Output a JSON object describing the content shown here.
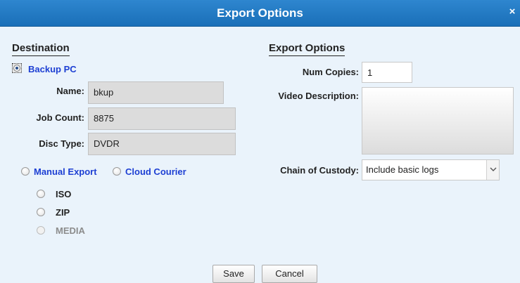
{
  "dialog": {
    "title": "Export Options",
    "close_label": "×"
  },
  "destination": {
    "heading": "Destination",
    "backup_pc": {
      "label": "Backup PC",
      "selected": true
    },
    "name_label": "Name:",
    "name_value": "bkup",
    "job_count_label": "Job Count:",
    "job_count_value": "8875",
    "disc_type_label": "Disc Type:",
    "disc_type_value": "DVDR",
    "manual_export_label": "Manual Export",
    "cloud_courier_label": "Cloud Courier",
    "formats": [
      {
        "label": "ISO",
        "enabled": true
      },
      {
        "label": "ZIP",
        "enabled": true
      },
      {
        "label": "MEDIA",
        "enabled": false
      }
    ]
  },
  "export_options": {
    "heading": "Export Options",
    "num_copies_label": "Num Copies:",
    "num_copies_value": "1",
    "video_description_label": "Video Description:",
    "video_description_value": "",
    "chain_of_custody_label": "Chain of Custody:",
    "chain_of_custody_value": "Include basic logs"
  },
  "buttons": {
    "save": "Save",
    "cancel": "Cancel"
  },
  "colors": {
    "title_bar": "#1f78c1",
    "link_blue": "#1d3fd3",
    "background": "#eaf3fb"
  }
}
